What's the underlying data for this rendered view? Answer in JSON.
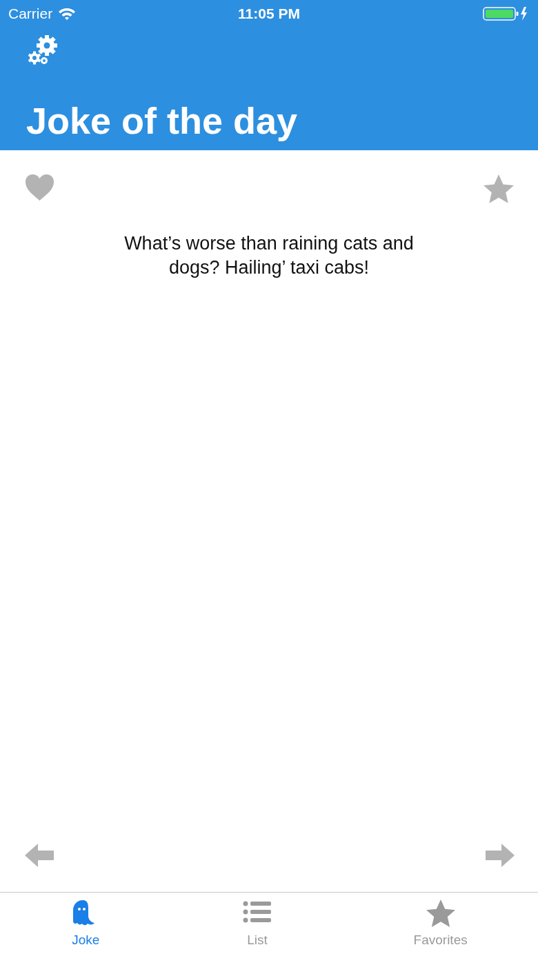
{
  "status_bar": {
    "carrier": "Carrier",
    "time": "11:05 PM"
  },
  "header": {
    "title": "Joke of the day"
  },
  "joke": {
    "text": "What’s worse than raining cats and dogs? Hailing’ taxi cabs!",
    "liked": false,
    "starred": false
  },
  "tabs": [
    {
      "label": "Joke",
      "kind": "ghost",
      "selected": true
    },
    {
      "label": "List",
      "kind": "list",
      "selected": false
    },
    {
      "label": "Favorites",
      "kind": "star",
      "selected": false
    }
  ]
}
